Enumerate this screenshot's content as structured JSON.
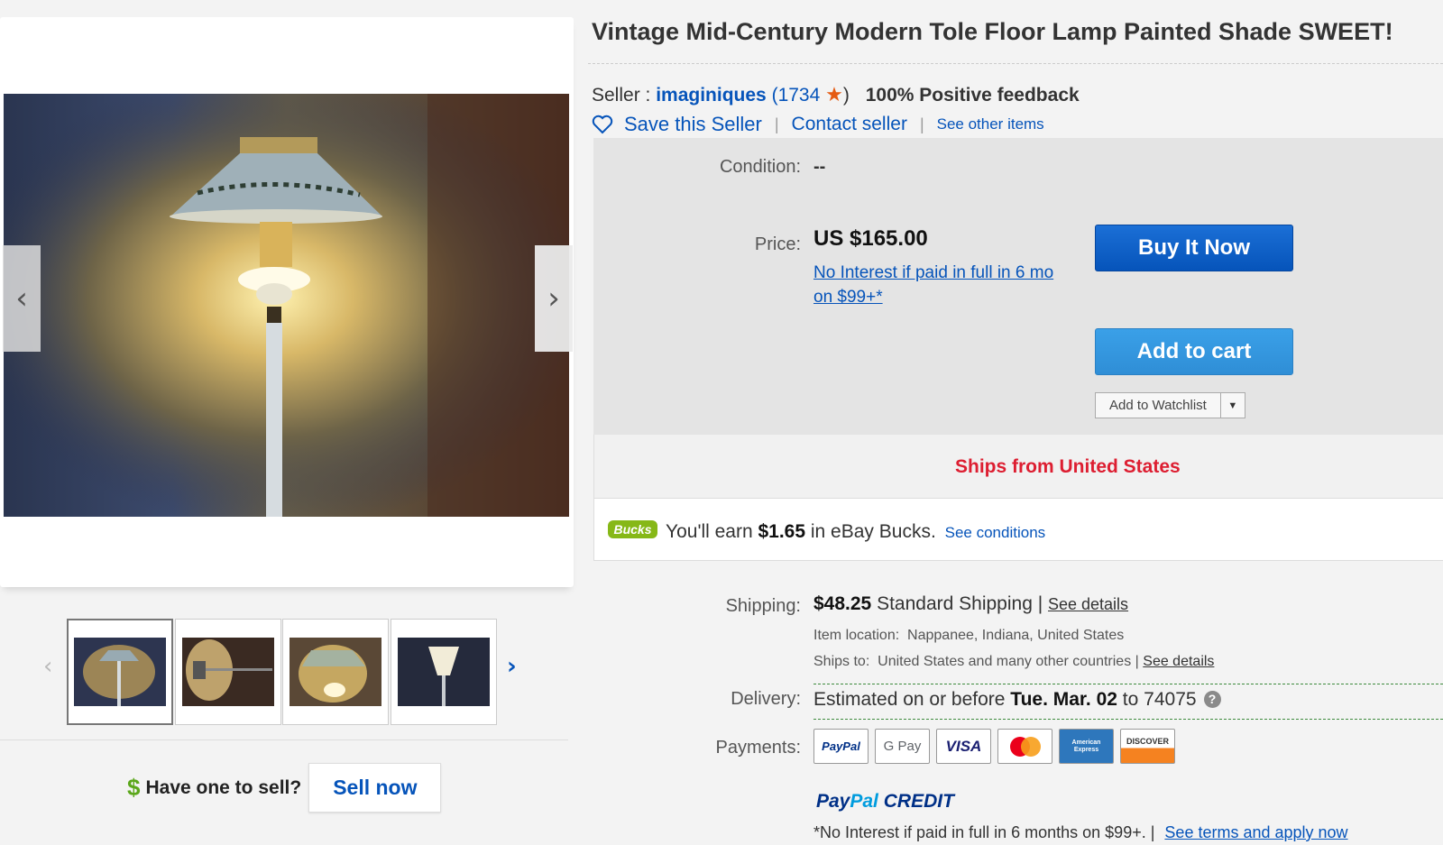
{
  "listing": {
    "title": "Vintage Mid-Century Modern Tole Floor Lamp Painted Shade SWEET!"
  },
  "seller": {
    "prefix": "Seller : ",
    "username": "imaginiques",
    "open_paren": "(",
    "score": "1734",
    "close_paren": ")",
    "feedback": "100% Positive feedback",
    "save_label": "Save this Seller",
    "contact_label": "Contact seller",
    "other_items_label": "See other items",
    "separator": "|"
  },
  "gallery": {
    "prev_glyph": "‹",
    "next_glyph": "›",
    "thumb_prev_glyph": "‹",
    "thumb_next_glyph": "›",
    "thumbnail_count": 4,
    "selected_thumbnail": 1
  },
  "sell": {
    "dollar": "$",
    "question": "Have one to sell?",
    "button": "Sell now"
  },
  "buy_box": {
    "condition_label": "Condition:",
    "condition_value": "--",
    "price_label": "Price:",
    "price_value": "US $165.00",
    "interest_text": "No Interest if paid in full in 6 mo on $99+*",
    "buy_now": "Buy It Now",
    "add_to_cart": "Add to cart",
    "watchlist": "Add to Watchlist",
    "watchlist_dd": "▼"
  },
  "ships_from": "Ships from United States",
  "bucks": {
    "logo": "Bucks",
    "pre": "You'll earn ",
    "amount": "$1.65",
    "post": " in eBay Bucks.",
    "conditions": "See conditions"
  },
  "shipping": {
    "label": "Shipping:",
    "cost": "$48.25",
    "method": " Standard Shipping | ",
    "details_link": "See details",
    "location_label": "Item location:",
    "location_value": "Nappanee, Indiana, United States",
    "ships_to_label": "Ships to:",
    "ships_to_value": "United States and many other countries |",
    "ships_to_link": "See details"
  },
  "delivery": {
    "label": "Delivery:",
    "pre": "Estimated on or before ",
    "date": "Tue. Mar. 02",
    "post": " to 74075",
    "help": "?"
  },
  "payments": {
    "label": "Payments:",
    "methods": [
      "PayPal",
      "G Pay",
      "VISA",
      "Mastercard",
      "American Express",
      "DISCOVER"
    ],
    "paypal_credit_a": "Pay",
    "paypal_credit_b": "Pal",
    "paypal_credit_c": " CREDIT",
    "fine_print": "*No Interest if paid in full in 6 months on $99+.  |",
    "terms_link": "See terms and apply now"
  },
  "colors": {
    "link_blue": "#0654ba",
    "buy_blue": "#0654ba",
    "cart_blue": "#3498db",
    "ships_red": "#dd1e31",
    "bucks_green": "#86b817"
  }
}
